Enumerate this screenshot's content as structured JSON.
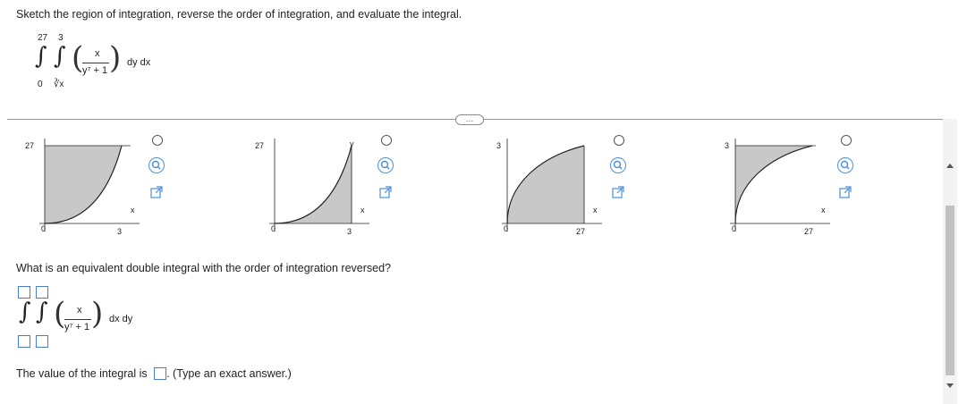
{
  "prompt": "Sketch the region of integration, reverse the order of integration, and evaluate the integral.",
  "integral": {
    "outer_upper": "27",
    "outer_lower": "0",
    "inner_upper": "3",
    "inner_lower": "∛x",
    "numerator": "x",
    "denominator": "y⁷ + 1",
    "differential": "dy dx"
  },
  "options": [
    {
      "id": "A",
      "top_y": "27",
      "x_max": "3",
      "x_axis": "x",
      "origin": "0"
    },
    {
      "id": "B",
      "top_y": "27",
      "x_max": "3",
      "x_axis": "x",
      "origin": "0",
      "curve_label": "y"
    },
    {
      "id": "C",
      "top_y": "3",
      "x_max": "27",
      "x_axis": "x",
      "origin": "0"
    },
    {
      "id": "D",
      "top_y": "3",
      "x_max": "27",
      "x_axis": "x",
      "origin": "0"
    }
  ],
  "more_label": "…",
  "question": "What is an equivalent double integral with the order of integration reversed?",
  "answer_integral": {
    "numerator": "x",
    "denominator": "y⁷ + 1",
    "differential": "dx dy"
  },
  "value_label": "The value of the integral is",
  "value_hint": ". (Type an exact answer.)",
  "colors": {
    "region_fill": "#c8c8c8",
    "accent": "#4a90d9",
    "box_border": "#4a7ec0"
  }
}
